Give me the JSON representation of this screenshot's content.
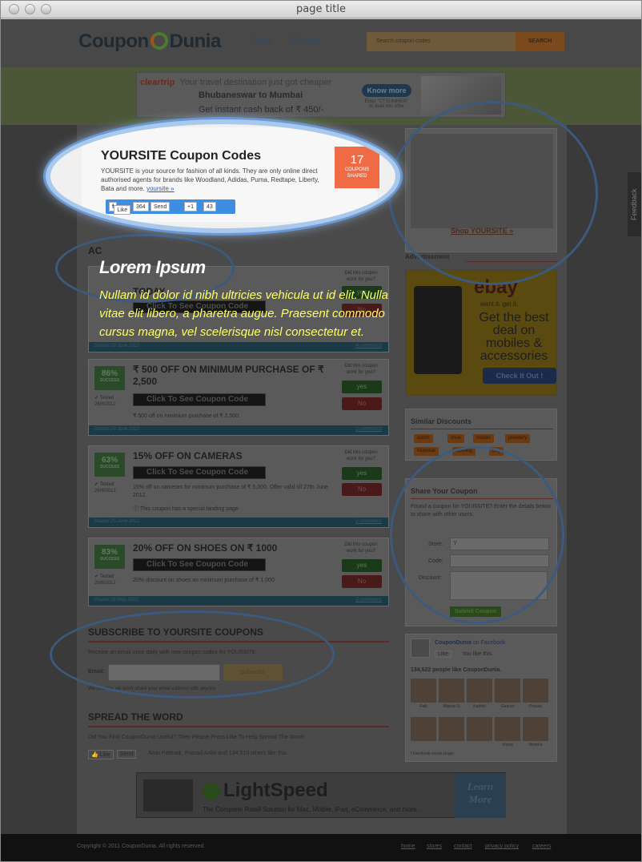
{
  "window": {
    "title": "page title"
  },
  "header": {
    "logo_left": "Coupon",
    "logo_right": "Dunia",
    "nav": [
      "Stores",
      "Contact"
    ],
    "search_placeholder": "Search coupon codes",
    "search_button": "SEARCH"
  },
  "top_ad": {
    "brand": "cleartrip",
    "line1": "Your travel destination just got cheaper",
    "line2": "Bhubaneswar to Mumbai",
    "line3": "Get instant cash back of ₹ 450/-",
    "button": "Know more",
    "note1": "Enter \"CTSUMMER\"",
    "note2": "to avail this offer"
  },
  "store": {
    "title": "YOURSITE Coupon Codes",
    "description": "YOURSITE is your source for fashion of all kinds. They are only online direct authorised agents for brands like Woodland, Adidas, Puma, Redtape, Liberty, Bata and more.",
    "link": "yoursite »",
    "count": "17",
    "count_label1": "COUPONS",
    "count_label2": "SHARED",
    "social": {
      "like": "Like",
      "like_count": "364",
      "send": "Send",
      "plus": "+1",
      "plus_count": "43"
    }
  },
  "overlay": {
    "heading": "Lorem Ipsum",
    "body": "Nullam id dolor id nibh ultricies vehicula ut id elit. Nulla vitae elit libero, a pharetra augue. Praesent commodo cursus magna, vel scelerisque nisl consectetur et."
  },
  "section_heading_partial": "AC",
  "coupons": [
    {
      "title": "TODAY",
      "button": "Click To See Coupon Code",
      "desc": "",
      "ask": "Did this coupon work for you?",
      "yes": "yes",
      "no": "No",
      "foot": "Shared 28 June 2012",
      "comments": "4 comments"
    },
    {
      "title": "₹ 500 OFF ON MINIMUM PURCHASE OF ₹ 2,500",
      "pct": "86%",
      "success": "SUCCESS",
      "tested": "Tested",
      "date": "26/6/2012",
      "button": "Click To See Coupon Code",
      "desc": "₹ 500 off on minimum purchase of ₹ 2,500.",
      "ask": "Did this coupon work for you?",
      "yes": "yes",
      "no": "No",
      "foot": "Shared 26 June 2012",
      "comments": "1 comments"
    },
    {
      "title": "15% OFF ON CAMERAS",
      "pct": "63%",
      "success": "SUCCESS",
      "tested": "Tested",
      "date": "26/6/2012",
      "button": "Click To See Coupon Code",
      "desc": "15% off on cameras for minimum purchase of ₹ 5,000. Offer valid till 27th June 2012.",
      "landing": "This coupon has a special landing page",
      "ask": "Did this coupon work for you?",
      "yes": "yes",
      "no": "No",
      "foot": "Shared 25 June 2012",
      "comments": "2 comments"
    },
    {
      "title": "20% OFF ON SHOES ON ₹ 1000",
      "pct": "83%",
      "success": "SUCCESS",
      "tested": "Tested",
      "date": "26/6/2012",
      "button": "Click To See Coupon Code",
      "desc": "20% discount on shoes on minimum purchase of ₹ 1,000",
      "ask": "Did this coupon work for you?",
      "yes": "yes",
      "no": "No",
      "foot": "Shared 28 May 2012",
      "comments": "3 comments"
    }
  ],
  "subscribe": {
    "heading": "SUBSCRIBE TO YOURSITE COUPONS",
    "text": "Receive an email once daily with new coupon codes for YOURSITE",
    "email_label": "Email:",
    "button": "Subscribe",
    "note": "We promise we won't share your email address with anyone"
  },
  "spread": {
    "heading": "SPREAD THE WORD",
    "text": "Did You Find CouponDunia Useful? Then Please Press Like To Help Spread The Word!",
    "like": "Like",
    "send": "Send",
    "friends": "Arun Pattnaik, Prasad Ankit and 134,519 others like this."
  },
  "sidebar": {
    "shop_link": "Shop YOURSITE »",
    "ad_label": "Advertisement",
    "ebay": {
      "logo": "ebay",
      "tagline": "want it. get it.",
      "headline": "Get the best deal on mobiles & accessories",
      "button": "Check It Out !"
    },
    "similar_heading": "Similar Discounts",
    "tags": [
      "watch",
      "shoe",
      "mobile",
      "jewellery",
      "footwear",
      "clothing",
      "bag"
    ],
    "share_heading": "Share Your Coupon",
    "share_text": "Found a coupon for YOURSITE? Enter the details below to share with other users:",
    "store_label": "Store:",
    "store_value": "Y",
    "code_label": "Code:",
    "discount_label": "Discount:",
    "submit": "Submit Coupon",
    "fb_name": "CouponDunia",
    "fb_on": "on Facebook",
    "fb_like": "Like",
    "fb_you": "You like this.",
    "fb_count": "134,522 people like CouponDunia.",
    "fans": [
      "Falk",
      "Mignon S",
      "Karthik",
      "Gaurav",
      "Prasad",
      "",
      "",
      "",
      "Vishal",
      "Nivetha"
    ],
    "fb_plugin": "Facebook social plugin"
  },
  "feedback": "Feedback",
  "bottom_ad": {
    "brand": "LightSpeed",
    "sub": "The Complete Retail Solution for Mac, Mobile, iPad, eCommerce, and more...",
    "learn": "Learn More"
  },
  "footer": {
    "copyright": "Copyright © 2011 CouponDunia. All rights reserved.",
    "links": [
      "home",
      "stores",
      "contact",
      "privacy policy",
      "careers"
    ]
  }
}
